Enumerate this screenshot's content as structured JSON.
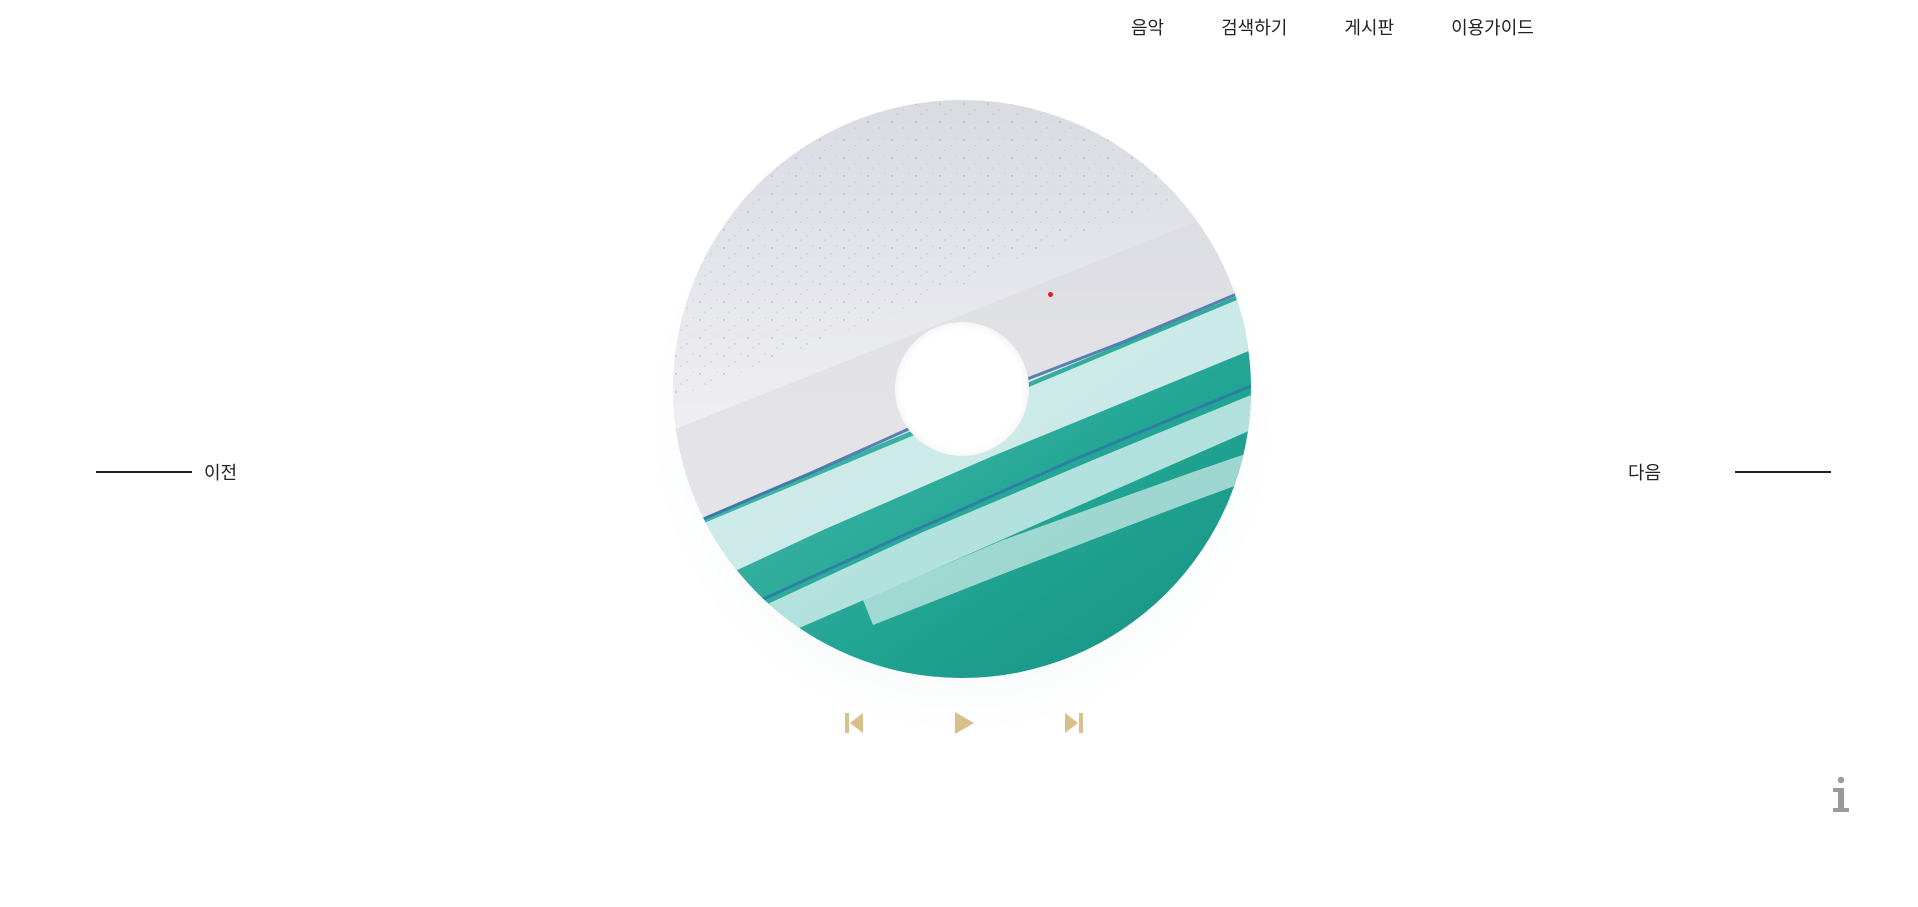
{
  "nav": {
    "items": [
      {
        "label": "음악"
      },
      {
        "label": "검색하기"
      },
      {
        "label": "게시판"
      },
      {
        "label": "이용가이드"
      }
    ]
  },
  "side": {
    "prev_label": "이전",
    "next_label": "다음"
  },
  "controls": {
    "icons": [
      "skip-back-icon",
      "play-icon",
      "skip-forward-icon"
    ],
    "color": "#d8c08a"
  },
  "disc": {
    "image": "beach-aerial-image",
    "colors": {
      "sand": "#e6e6ea",
      "sea": "#28a898",
      "foam": "#dff2f2"
    }
  },
  "info": {
    "icon": "info-icon",
    "color": "#9a9a9a"
  }
}
